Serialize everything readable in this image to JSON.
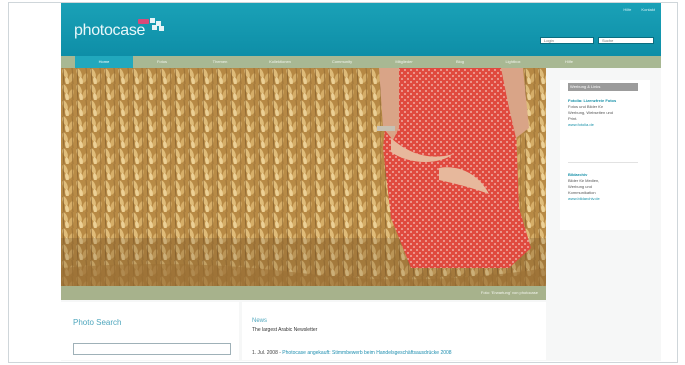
{
  "brand": {
    "logo_text": "photocase",
    "badge_color": "#d94a79",
    "header_color": "#1aa1b7",
    "nav_color": "#a8b893",
    "accent_color": "#21a8bd"
  },
  "header": {
    "top_links": [
      "Hilfe",
      "Kontakt"
    ],
    "login_field": "Login",
    "search_field": "Suche"
  },
  "nav": {
    "items": [
      "Home",
      "Fotos",
      "Themen",
      "Kollektionen",
      "Community",
      "Mitglieder",
      "Blog",
      "Lightbox",
      "Hilfe"
    ]
  },
  "hero": {
    "description": "",
    "caption": "Foto: 'Erwartung' von photocase"
  },
  "sidebar": {
    "heading": "Werbung & Links",
    "boxes": [
      {
        "title": "Fotolia: Lizenzfreie Fotos",
        "lines": [
          "Fotos und Bilder für",
          "Werbung, Webseiten und",
          "Print."
        ],
        "url": "www.fotolia.de"
      },
      {
        "title": "Bildarchiv",
        "lines": [
          "Bilder für Medien,",
          "Werbung und",
          "Kommunikation"
        ],
        "url": "www.bildarchiv.de"
      }
    ]
  },
  "photo_search": {
    "title": "Photo Search",
    "input_value": ""
  },
  "news": {
    "title": "News",
    "subtitle": "The largest Arabic Newsletter",
    "items": [
      {
        "date": "1. Jul. 2008 -",
        "link_text": "Photocase angekauft: Stimmbewerb beim Handelsgeschäftsausdrücke 2008"
      }
    ]
  }
}
